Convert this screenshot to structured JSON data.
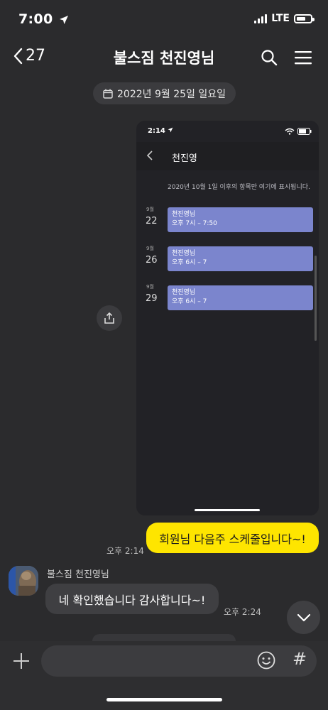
{
  "status_bar": {
    "time": "7:00",
    "network": "LTE"
  },
  "header": {
    "back_count": "27",
    "title": "불스짐 천진영님"
  },
  "date_divider": "2022년 9월 25일 일요일",
  "shared_image": {
    "status_time": "2:14",
    "title": "천진영",
    "info": "2020년 10월 1일 이후의 항목만 여기에 표시됩니다.",
    "events": [
      {
        "month": "9월",
        "day": "22",
        "title": "천진영님",
        "time": "오후 7시 – 7:50"
      },
      {
        "month": "9월",
        "day": "26",
        "title": "천진영님",
        "time": "오후 6시 – 7"
      },
      {
        "month": "9월",
        "day": "29",
        "title": "천진영님",
        "time": "오후 6시 – 7"
      }
    ]
  },
  "messages": [
    {
      "sender": "me",
      "text": "회원님 다음주 스케줄입니다~!",
      "time": "오후 2:14"
    },
    {
      "sender": "불스짐 천진영님",
      "text": "네 확인했습니다 감사합니다~!",
      "time": "오후 2:24"
    }
  ],
  "input": {
    "hash_label": "#"
  },
  "colors": {
    "my_bubble": "#fee500",
    "other_bubble": "#3f3f42",
    "background": "#2b2b2d",
    "event_card": "#7b85cd"
  }
}
